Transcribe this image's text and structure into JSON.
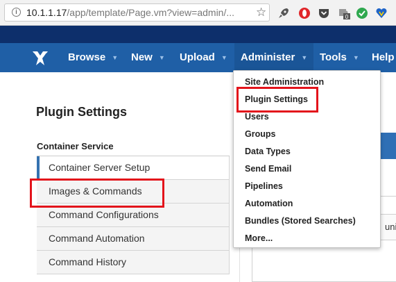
{
  "browser": {
    "url_host": "10.1.1.17",
    "url_path": "/app/template/Page.vm?view=admin/...",
    "extensions": [
      "rocket-icon",
      "opera-icon",
      "pocket-icon",
      "puzzle-badge-icon",
      "check-icon",
      "vpn-heart-icon"
    ],
    "badge_count": "0"
  },
  "nav": {
    "items": [
      {
        "label": "Browse"
      },
      {
        "label": "New"
      },
      {
        "label": "Upload"
      },
      {
        "label": "Administer"
      },
      {
        "label": "Tools"
      },
      {
        "label": "Help"
      }
    ],
    "caret": "▼",
    "brand_color": "#1f5fa6",
    "dark_band_color": "#0d2f6b"
  },
  "page": {
    "title": "Plugin Settings",
    "section_heading": "Container Service",
    "sidebar": [
      {
        "label": "Container Server Setup",
        "active": true
      },
      {
        "label": "Images & Commands"
      },
      {
        "label": "Command Configurations"
      },
      {
        "label": "Command Automation"
      },
      {
        "label": "Command History"
      }
    ],
    "background_cell_text": "uni"
  },
  "dropdown": {
    "items": [
      {
        "label": "Site Administration"
      },
      {
        "label": "Plugin Settings"
      },
      {
        "label": "Users"
      },
      {
        "label": "Groups"
      },
      {
        "label": "Data Types"
      },
      {
        "label": "Send Email"
      },
      {
        "label": "Pipelines"
      },
      {
        "label": "Automation"
      },
      {
        "label": "Bundles (Stored Searches)"
      },
      {
        "label": "More..."
      }
    ]
  },
  "annotation_color": "#e3131b"
}
